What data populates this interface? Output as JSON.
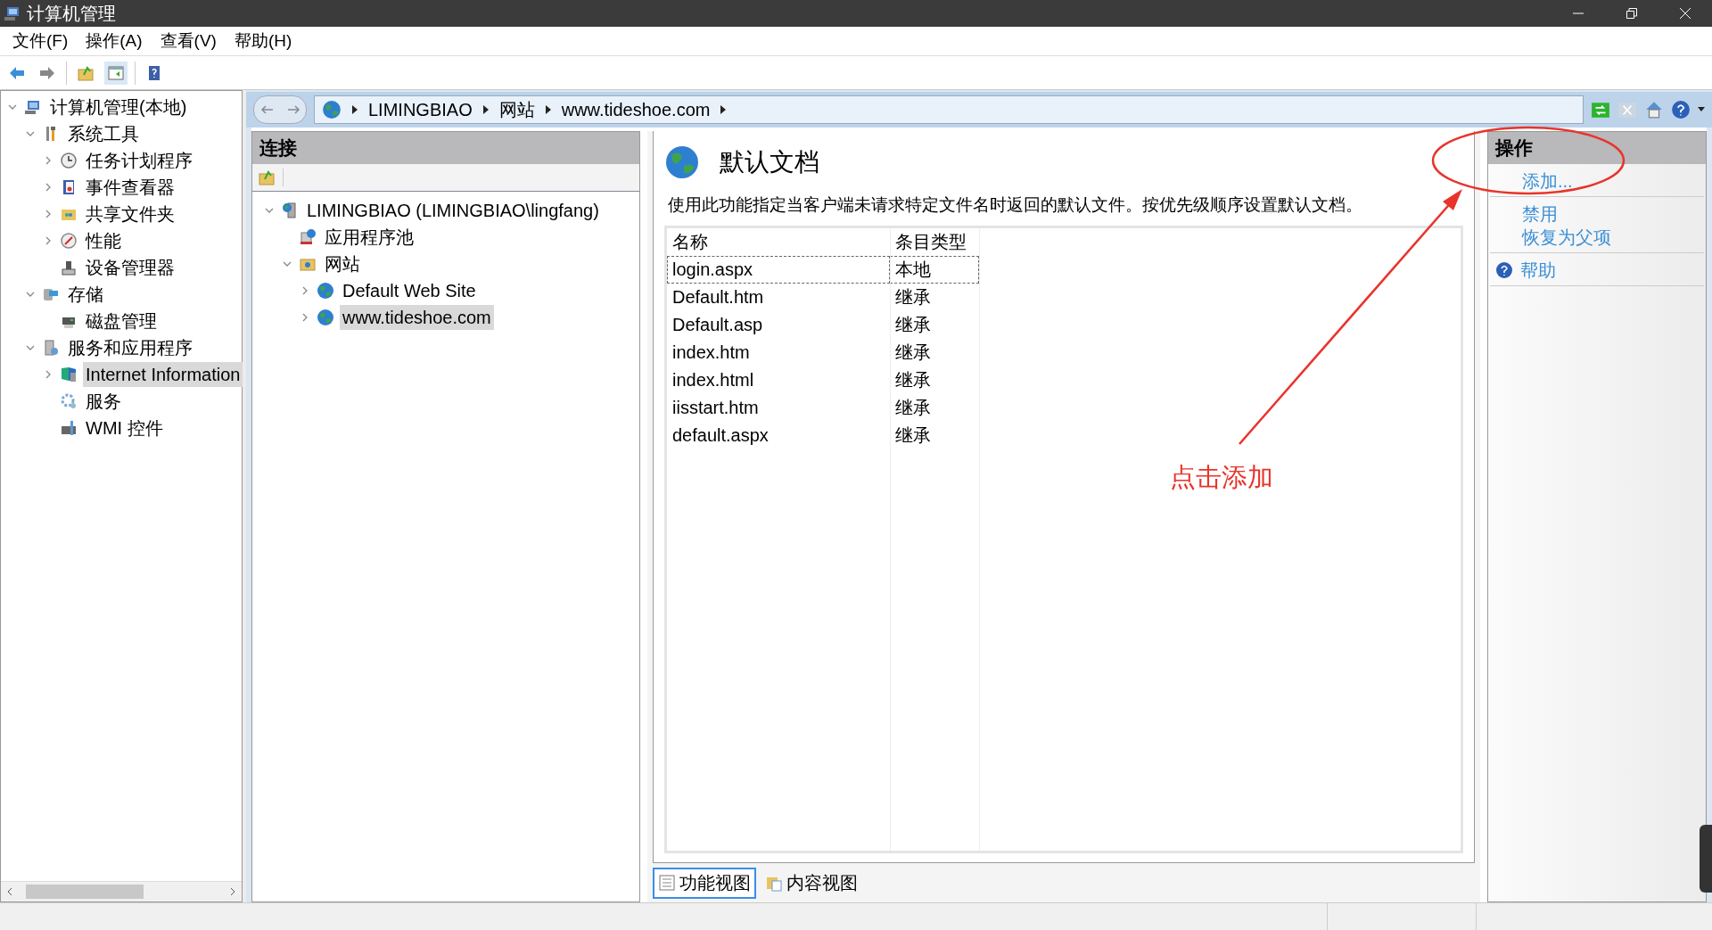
{
  "window": {
    "title": "计算机管理"
  },
  "menu": [
    "文件(F)",
    "操作(A)",
    "查看(V)",
    "帮助(H)"
  ],
  "tree": [
    {
      "label": "计算机管理(本地)",
      "expanded": true,
      "children": [
        {
          "label": "系统工具",
          "expanded": true,
          "children": [
            {
              "label": "任务计划程序",
              "expanded": false
            },
            {
              "label": "事件查看器",
              "expanded": false
            },
            {
              "label": "共享文件夹",
              "expanded": false
            },
            {
              "label": "性能",
              "expanded": false
            },
            {
              "label": "设备管理器"
            }
          ]
        },
        {
          "label": "存储",
          "expanded": true,
          "children": [
            {
              "label": "磁盘管理"
            }
          ]
        },
        {
          "label": "服务和应用程序",
          "expanded": true,
          "children": [
            {
              "label": "Internet Information",
              "expanded": false,
              "selected": true
            },
            {
              "label": "服务"
            },
            {
              "label": "WMI 控件"
            }
          ]
        }
      ]
    }
  ],
  "breadcrumb": [
    "LIMINGBIAO",
    "网站",
    "www.tideshoe.com"
  ],
  "connections": {
    "title": "连接",
    "tree": [
      {
        "label": "LIMINGBIAO (LIMINGBIAO\\lingfang)",
        "expanded": true,
        "children": [
          {
            "label": "应用程序池"
          },
          {
            "label": "网站",
            "expanded": true,
            "children": [
              {
                "label": "Default Web Site",
                "expanded": false,
                "selected": false
              },
              {
                "label": "www.tideshoe.com",
                "expanded": false,
                "selected": true
              }
            ]
          }
        ]
      }
    ]
  },
  "feature": {
    "title": "默认文档",
    "description": "使用此功能指定当客户端未请求特定文件名时返回的默认文件。按优先级顺序设置默认文档。",
    "table": {
      "columns": [
        "名称",
        "条目类型"
      ],
      "rows": [
        {
          "cells": [
            "login.aspx",
            "本地"
          ],
          "selected": true
        },
        {
          "cells": [
            "Default.htm",
            "继承"
          ],
          "selected": false
        },
        {
          "cells": [
            "Default.asp",
            "继承"
          ],
          "selected": false
        },
        {
          "cells": [
            "index.htm",
            "继承"
          ],
          "selected": false
        },
        {
          "cells": [
            "index.html",
            "继承"
          ],
          "selected": false
        },
        {
          "cells": [
            "iisstart.htm",
            "继承"
          ],
          "selected": false
        },
        {
          "cells": [
            "default.aspx",
            "继承"
          ],
          "selected": false
        }
      ]
    }
  },
  "view_tabs": [
    {
      "label": "功能视图",
      "selected": true
    },
    {
      "label": "内容视图",
      "selected": false
    }
  ],
  "actions": {
    "title": "操作",
    "groups": [
      [
        {
          "label": "添加...",
          "kind": "link"
        }
      ],
      [
        {
          "label": "禁用",
          "kind": "link"
        },
        {
          "label": "恢复为父项",
          "kind": "link"
        }
      ],
      [
        {
          "label": "帮助",
          "kind": "help"
        }
      ]
    ]
  },
  "annotation": {
    "label": "点击添加"
  }
}
